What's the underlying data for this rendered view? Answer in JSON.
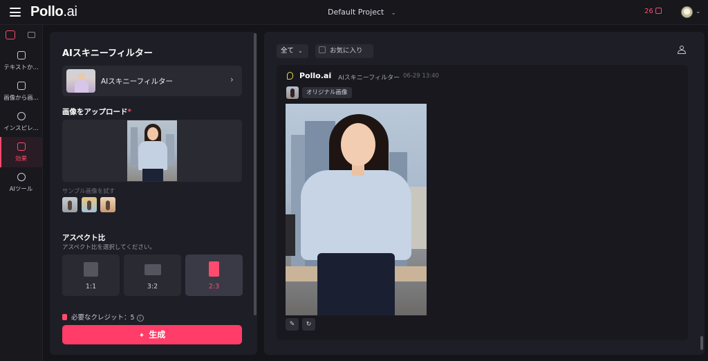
{
  "header": {
    "logo_main": "Pollo",
    "logo_suffix": ".ai",
    "project": "Default Project",
    "credits": "26"
  },
  "nav": {
    "items": [
      {
        "label": "テキストか..."
      },
      {
        "label": "画像から画..."
      },
      {
        "label": "インスピレ..."
      },
      {
        "label": "効果"
      },
      {
        "label": "AIツール"
      }
    ]
  },
  "panel": {
    "title": "AIスキニーフィルター",
    "filter_name": "AIスキニーフィルター",
    "upload_label": "画像をアップロード",
    "required_mark": "*",
    "sample_label": "サンプル画像を試す",
    "aspect_title": "アスペクト比",
    "aspect_sub": "アスペクト比を選択してください。",
    "aspect_options": [
      {
        "label": "1:1"
      },
      {
        "label": "3:2"
      },
      {
        "label": "2:3"
      }
    ],
    "selected_aspect": "2:3",
    "credits_needed": "必要なクレジット：5",
    "generate_label": "生成"
  },
  "results": {
    "filter_select": "全て",
    "favorites_label": "お気に入り",
    "brand": "Pollo.ai",
    "tool_name": "AIスキニーフィルター",
    "time": "06-29 13:40",
    "original_tag": "オリジナル画像"
  },
  "colors": {
    "accent": "#ff3d68",
    "background": "#141419",
    "panel": "#1e1e26"
  },
  "icons": {
    "menu": "hamburger-icon",
    "credits": "coin-icon",
    "generate": "sparkle-icon",
    "edit": "pencil-icon",
    "regenerate": "refresh-icon",
    "person": "person-icon"
  }
}
